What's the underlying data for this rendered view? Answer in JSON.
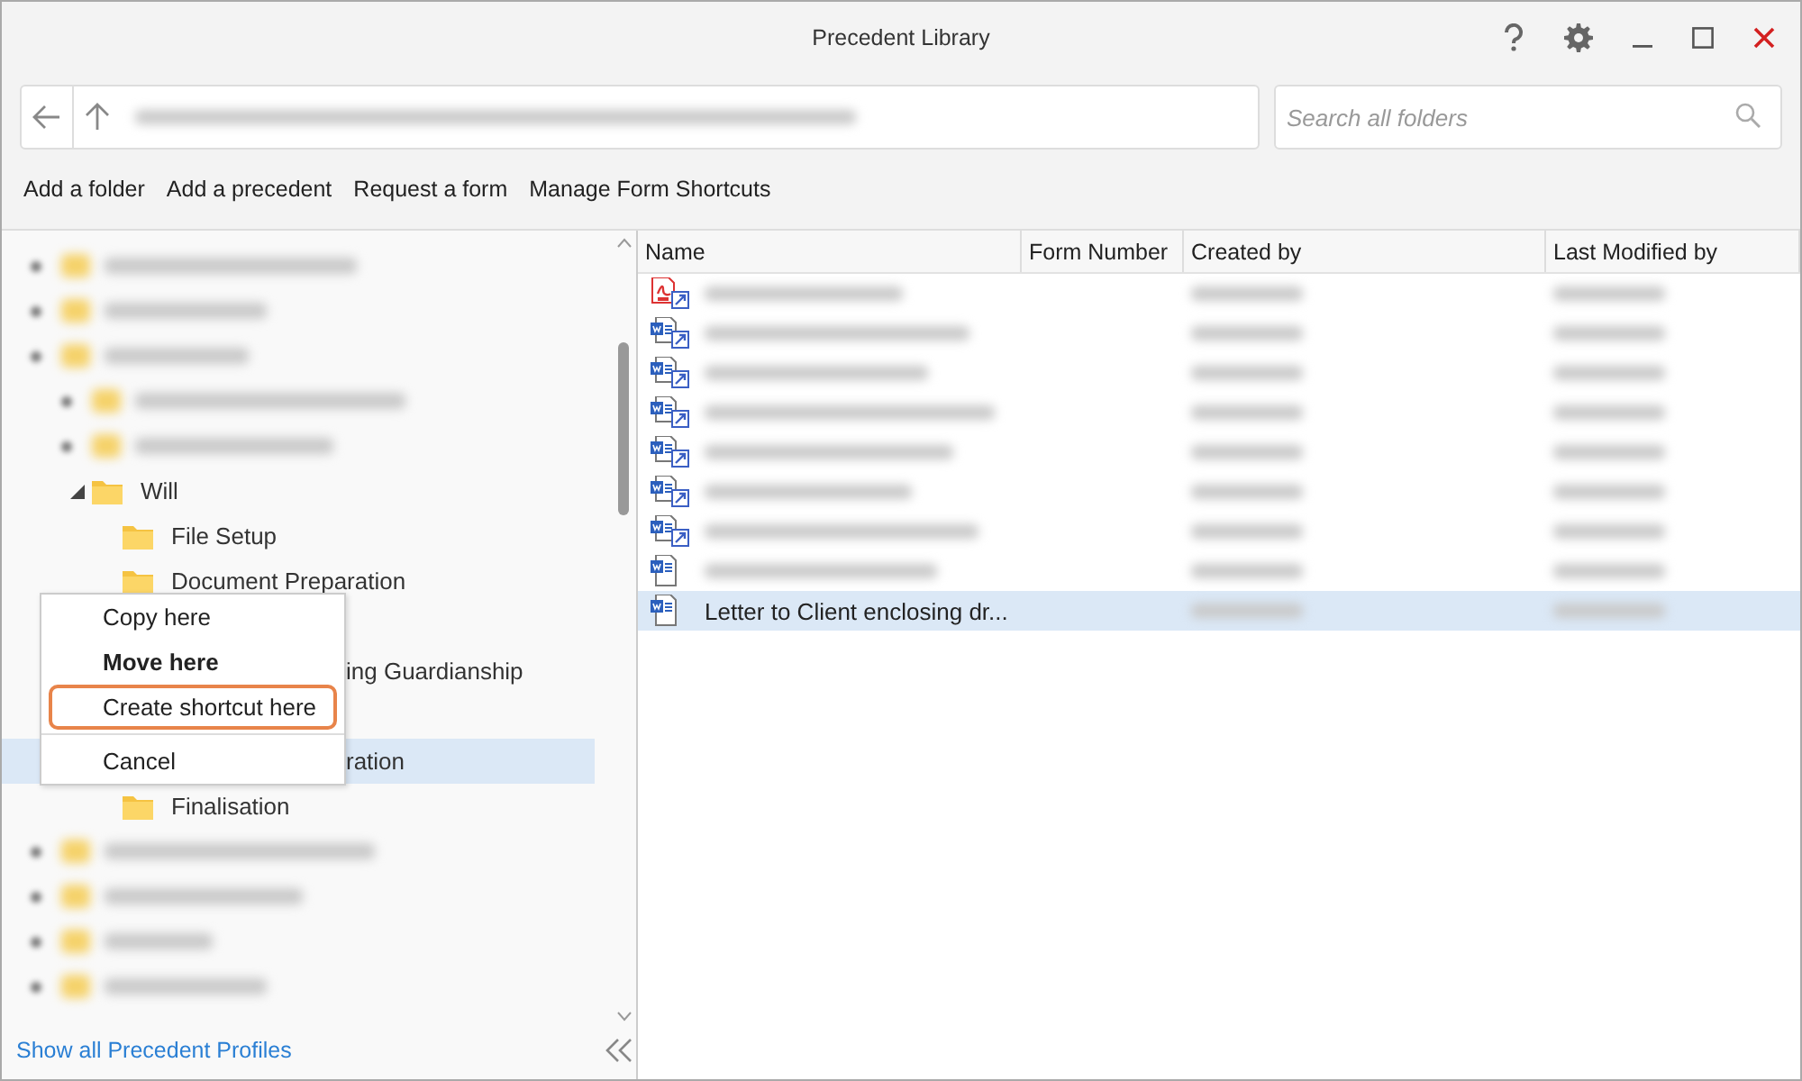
{
  "window": {
    "title": "Precedent Library"
  },
  "search": {
    "placeholder": "Search all folders"
  },
  "toolbar": [
    "Add a folder",
    "Add a precedent",
    "Request a form",
    "Manage Form Shortcuts"
  ],
  "tree": [
    {
      "kind": "blurred",
      "expanded": false
    },
    {
      "kind": "blurred",
      "expanded": false
    },
    {
      "kind": "blurred",
      "expanded": true,
      "children": [
        {
          "kind": "blurred",
          "expanded": false
        },
        {
          "kind": "blurred",
          "expanded": false
        },
        {
          "kind": "folder",
          "label": "Will",
          "expanded": true,
          "selected": false,
          "children": [
            {
              "kind": "folder",
              "label": "File Setup",
              "selected": false
            },
            {
              "kind": "folder",
              "label": "Document Preparation",
              "selected": false
            },
            {
              "kind": "covered"
            },
            {
              "kind": "partial",
              "label": "ing Guardianship",
              "selected": false
            },
            {
              "kind": "covered"
            },
            {
              "kind": "partial",
              "label": "ration",
              "selected": true
            },
            {
              "kind": "folder",
              "label": "Finalisation",
              "selected": false
            }
          ]
        }
      ]
    },
    {
      "kind": "blurred",
      "expanded": false
    },
    {
      "kind": "blurred",
      "expanded": false
    },
    {
      "kind": "blurred",
      "expanded": false
    },
    {
      "kind": "blurred",
      "expanded": false
    }
  ],
  "context_menu": [
    {
      "label": "Copy here",
      "default": false,
      "highlighted": false
    },
    {
      "label": "Move here",
      "default": true,
      "highlighted": false
    },
    {
      "label": "Create shortcut here",
      "default": false,
      "highlighted": true
    },
    {
      "label": "Cancel",
      "default": false,
      "highlighted": false,
      "separator_before": true
    }
  ],
  "footer_link": "Show all Precedent Profiles",
  "table": {
    "columns": [
      "Name",
      "Form Number",
      "Created by",
      "Last Modified by"
    ],
    "rows": [
      {
        "kind": "pdf-shortcut",
        "selected": false
      },
      {
        "kind": "document-shortcut",
        "selected": false
      },
      {
        "kind": "document-shortcut",
        "selected": false
      },
      {
        "kind": "document-shortcut",
        "selected": false
      },
      {
        "kind": "document-shortcut",
        "selected": false
      },
      {
        "kind": "document-shortcut",
        "selected": false
      },
      {
        "kind": "document-shortcut",
        "selected": false
      },
      {
        "kind": "document",
        "selected": false
      },
      {
        "kind": "document",
        "name": "Letter to Client enclosing dr...",
        "selected": true
      }
    ]
  }
}
